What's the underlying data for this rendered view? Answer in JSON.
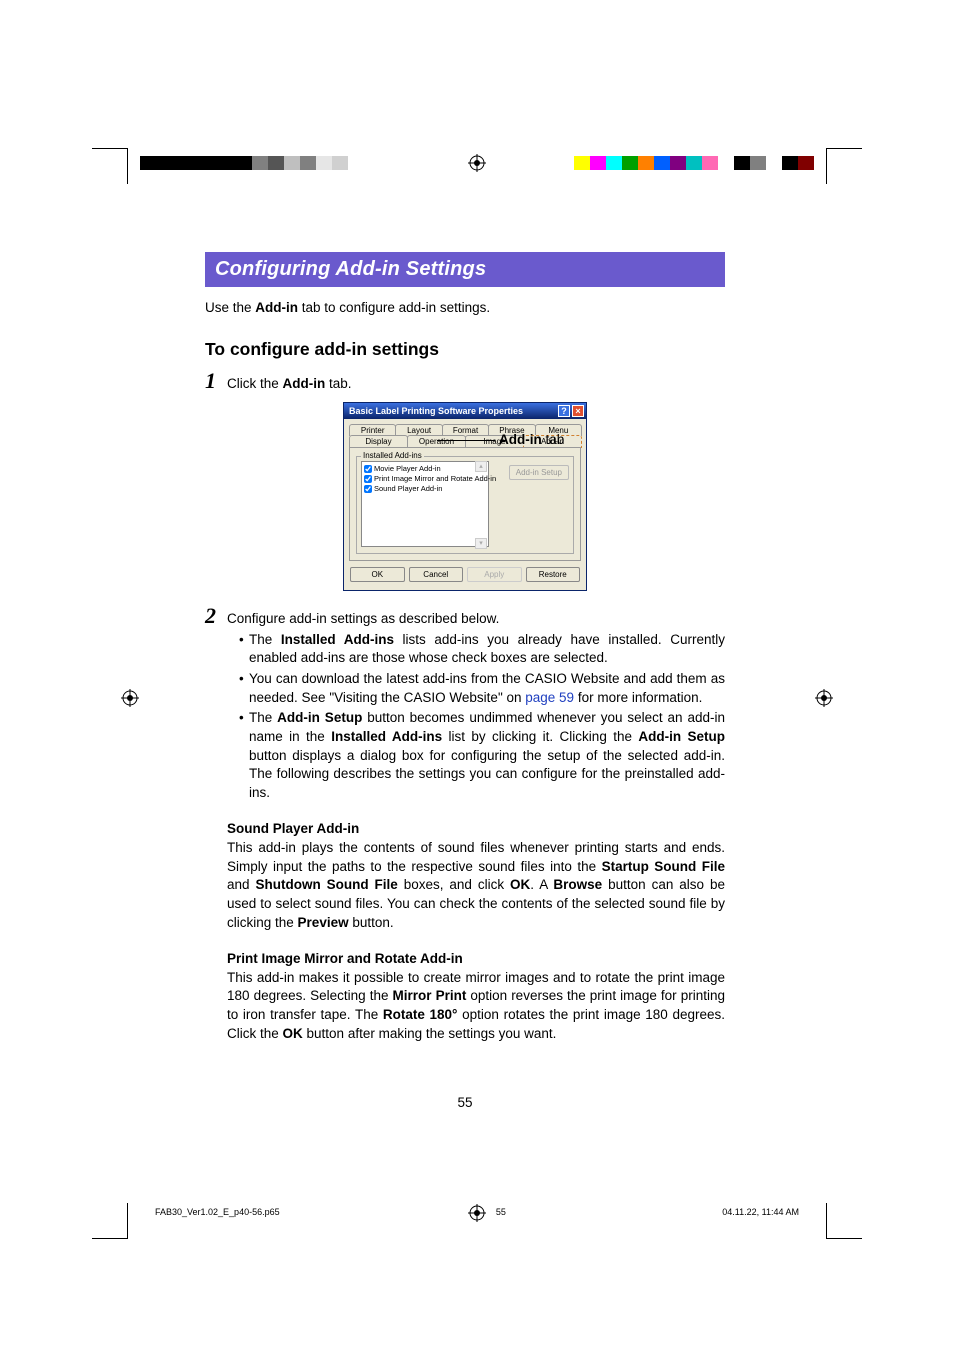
{
  "colorbars": {
    "left": [
      "#000",
      "#000",
      "#000",
      "#000",
      "#000",
      "#000",
      "#000",
      "#808080",
      "#555",
      "#bfbfbf",
      "#808080",
      "#e6e6e6",
      "#d0d0d0",
      "#fff",
      "#fff"
    ],
    "right": [
      "#ffff00",
      "#ff00ff",
      "#00ffff",
      "#00a000",
      "#ff8000",
      "#0060ff",
      "#800080",
      "#00c0c0",
      "#ff69b4",
      "#fff",
      "#000",
      "#808080",
      "#fff",
      "#000",
      "#800000"
    ]
  },
  "heading": "Configuring Add-in Settings",
  "intro_pre": "Use the ",
  "intro_bold": "Add-in",
  "intro_post": " tab to configure add-in settings.",
  "section_head": "To configure add-in settings",
  "step1_num": "1",
  "step1_pre": "Click the ",
  "step1_bold": "Add-in",
  "step1_post": " tab.",
  "dialog": {
    "title": "Basic Label Printing Software Properties",
    "help": "?",
    "close": "×",
    "tabs_row1": [
      "Printer",
      "Layout",
      "Format",
      "Phrase",
      "Menu"
    ],
    "tabs_row2": [
      "Display",
      "Operation",
      "Image",
      "Add-in"
    ],
    "active_tab": "Add-in",
    "group_label": "Installed Add-ins",
    "addins": [
      {
        "checked": true,
        "label": "Movie Player Add-in"
      },
      {
        "checked": true,
        "label": "Print Image Mirror and Rotate Add-in"
      },
      {
        "checked": true,
        "label": "Sound Player Add-in"
      }
    ],
    "setup_btn": "Add-in Setup",
    "buttons": {
      "ok": "OK",
      "cancel": "Cancel",
      "apply": "Apply",
      "restore": "Restore"
    }
  },
  "callout_bold": "Add-in",
  "callout_post": " tab",
  "step2_num": "2",
  "step2_text": "Configure add-in settings as described below.",
  "bullets": [
    {
      "pre": "The ",
      "b1": "Installed Add-ins",
      "mid": " lists add-ins you already have installed. Currently enabled add-ins are those whose check boxes are selected."
    },
    {
      "pre": "You can download the latest add-ins from the CASIO Website and add them as needed. See \"Visiting the CASIO Website\" on ",
      "link": "page 59",
      "post": " for more information."
    },
    {
      "pre": "The ",
      "b1": "Add-in Setup",
      "mid": " button becomes undimmed whenever you select an add-in name in the ",
      "b2": "Installed Add-ins",
      "mid2": " list by clicking it. Clicking the ",
      "b3": "Add-in Setup",
      "post": " button displays a dialog box for configuring the setup of the selected add-in.  The following describes the settings you can configure for the preinstalled add-ins."
    }
  ],
  "sp_head": "Sound Player Add-in",
  "sp_p1_pre": "This add-in plays the contents of sound files whenever printing starts and ends. Simply input the paths to the respective sound files into the ",
  "sp_b1": "Startup Sound File",
  "sp_mid1": " and ",
  "sp_b2": "Shutdown Sound File",
  "sp_mid2": " boxes, and click ",
  "sp_b3": "OK",
  "sp_mid3": ". A ",
  "sp_b4": "Browse",
  "sp_mid4": " button can also be used to select sound files. You can check the contents of the selected sound file by clicking the ",
  "sp_b5": "Preview",
  "sp_post": " button.",
  "pr_head": "Print Image Mirror and Rotate Add-in",
  "pr_p1_pre": "This add-in makes it possible to create mirror images and to rotate the print image 180 degrees. Selecting the ",
  "pr_b1": "Mirror Print",
  "pr_mid1": " option reverses the print image for printing to iron transfer tape. The ",
  "pr_b2": "Rotate 180°",
  "pr_mid2": " option rotates the print image 180 degrees. Click the ",
  "pr_b3": "OK",
  "pr_post": " button after making the settings you want.",
  "page_number": "55",
  "footer": {
    "file": "FAB30_Ver1.02_E_p40-56.p65",
    "page": "55",
    "date": "04.11.22, 11:44 AM"
  }
}
